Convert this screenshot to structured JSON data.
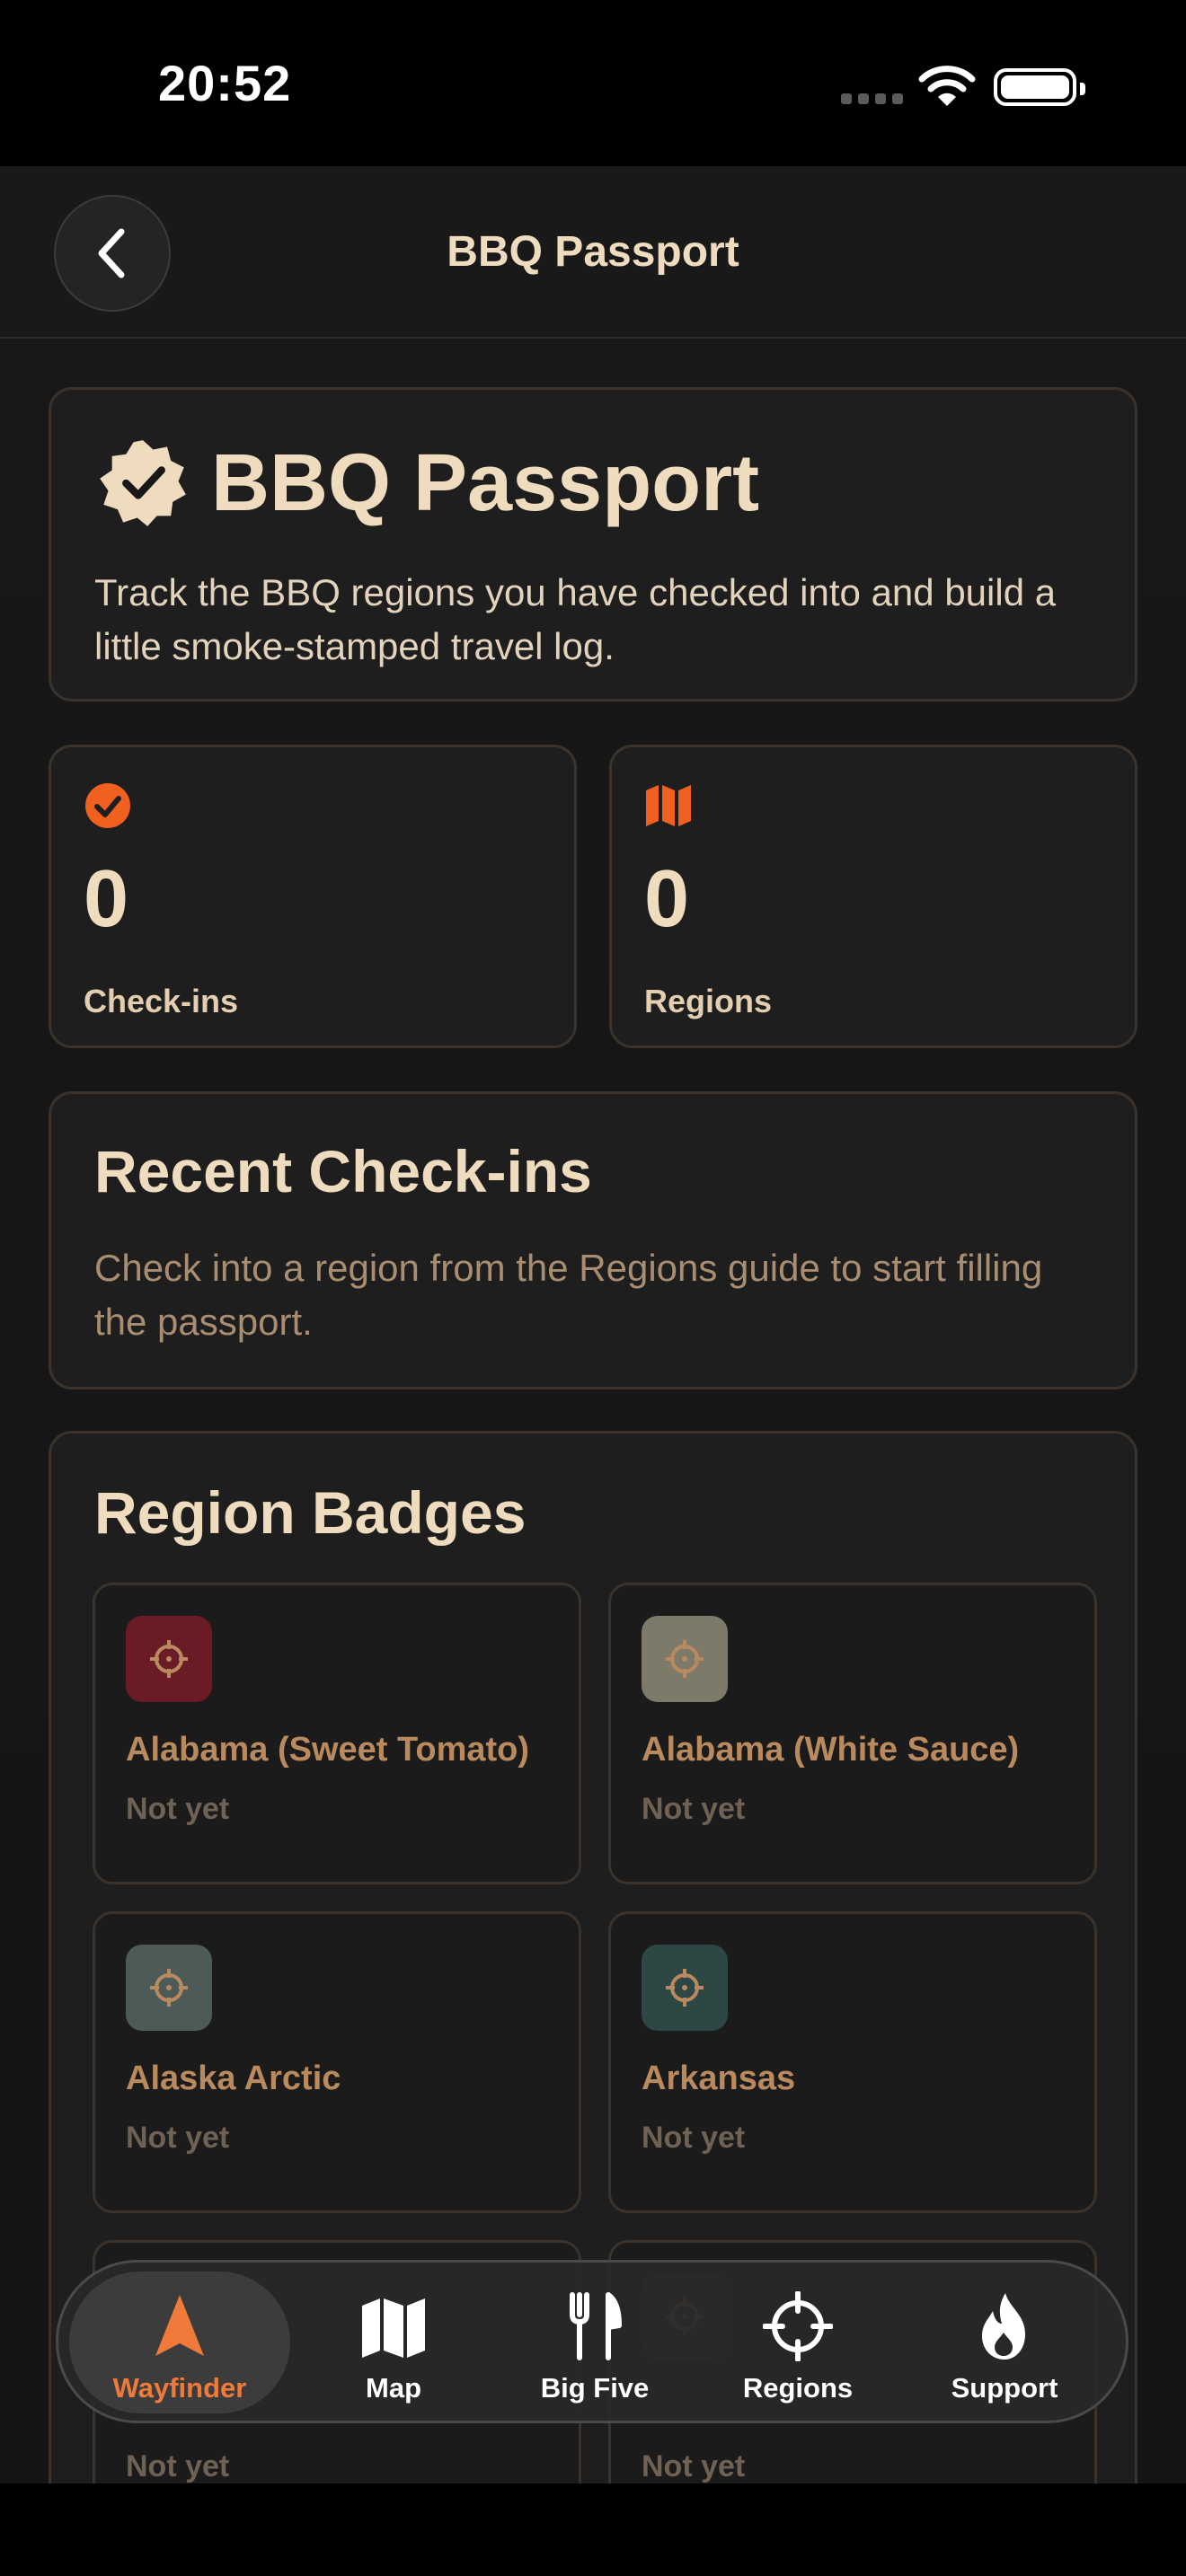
{
  "status_bar": {
    "time": "20:52"
  },
  "nav": {
    "title": "BBQ Passport"
  },
  "hero": {
    "title": "BBQ Passport",
    "description": "Track the BBQ regions you have checked into and build a little smoke-stamped travel log."
  },
  "stats": {
    "checkins": {
      "value": "0",
      "label": "Check-ins"
    },
    "regions": {
      "value": "0",
      "label": "Regions"
    }
  },
  "recent": {
    "title": "Recent Check-ins",
    "description": "Check into a region from the Regions guide to start filling the passport."
  },
  "badges": {
    "title": "Region Badges",
    "items": [
      {
        "name": "Alabama (Sweet Tomato)",
        "status": "Not yet",
        "color": "#6b1b26"
      },
      {
        "name": "Alabama (White Sauce)",
        "status": "Not yet",
        "color": "#7d7a6a"
      },
      {
        "name": "Alaska Arctic",
        "status": "Not yet",
        "color": "#4c5a58"
      },
      {
        "name": "Arkansas",
        "status": "Not yet",
        "color": "#2d4744"
      },
      {
        "name": "",
        "status": "Not yet",
        "color": "#5a3a24"
      },
      {
        "name": "",
        "status": "Not yet",
        "color": "#2e3d24"
      }
    ]
  },
  "tabs": [
    {
      "label": "Wayfinder",
      "icon": "navigation-arrow-icon",
      "active": true
    },
    {
      "label": "Map",
      "icon": "map-icon",
      "active": false
    },
    {
      "label": "Big Five",
      "icon": "fork-knife-icon",
      "active": false
    },
    {
      "label": "Regions",
      "icon": "crosshair-icon",
      "active": false
    },
    {
      "label": "Support",
      "icon": "flame-icon",
      "active": false
    }
  ],
  "colors": {
    "accent": "#f0601e",
    "background": "#181818",
    "text": "#efdcbe"
  }
}
